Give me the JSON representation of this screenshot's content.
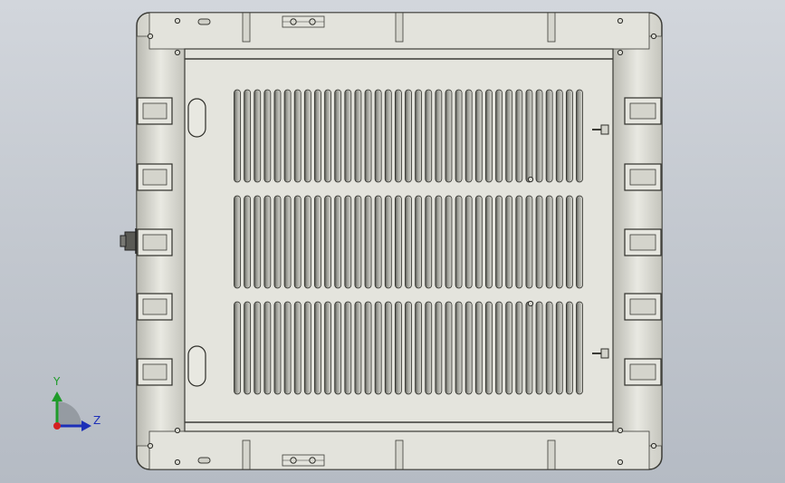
{
  "app": {
    "view": "CAD 3D viewport"
  },
  "triad": {
    "y_label": "Y",
    "z_label": "Z",
    "colors": {
      "y": "#1f9b2a",
      "z": "#1c2fb8",
      "x": "#d42020"
    }
  },
  "model": {
    "kind": "ventilated enclosure panel",
    "colors": {
      "body": "#e3e3dc",
      "edge": "#3b3b36",
      "slot": "#6f706a",
      "background_top": "#d2d6dc",
      "background_bottom": "#b5bbc4"
    },
    "vent_rows": 3,
    "slots_per_row": 35,
    "side_handles_per_side": 5
  }
}
